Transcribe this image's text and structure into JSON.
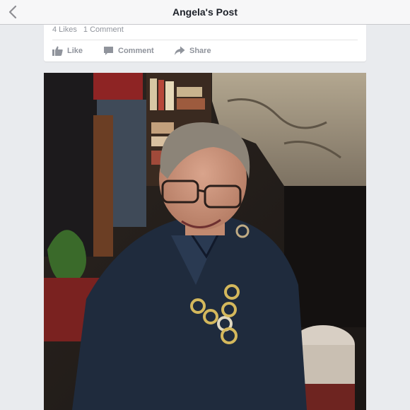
{
  "nav": {
    "title": "Angela's Post",
    "back_icon": "chevron-left-icon"
  },
  "post": {
    "likes": "4 Likes",
    "comments": "1 Comment",
    "actions": {
      "like": "Like",
      "comment": "Comment",
      "share": "Share"
    }
  },
  "colors": {
    "accent": "#90949c",
    "background": "#e9ebee",
    "nav_bar": "#f7f7f8"
  }
}
